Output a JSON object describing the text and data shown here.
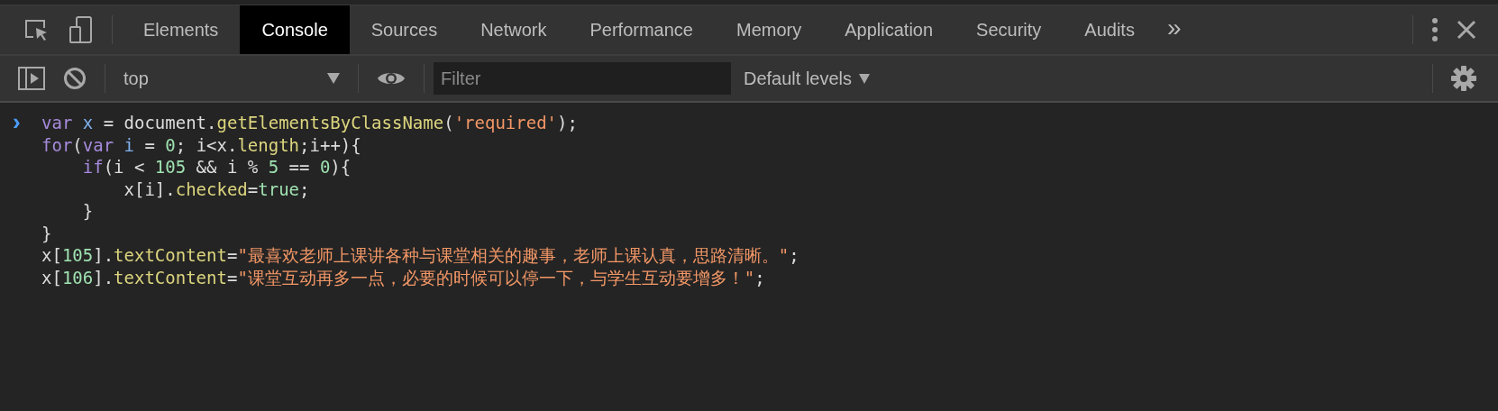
{
  "tabs": [
    {
      "label": "Elements",
      "selected": false
    },
    {
      "label": "Console",
      "selected": true
    },
    {
      "label": "Sources",
      "selected": false
    },
    {
      "label": "Network",
      "selected": false
    },
    {
      "label": "Performance",
      "selected": false
    },
    {
      "label": "Memory",
      "selected": false
    },
    {
      "label": "Application",
      "selected": false
    },
    {
      "label": "Security",
      "selected": false
    },
    {
      "label": "Audits",
      "selected": false
    }
  ],
  "more_tabs": "»",
  "toolbar": {
    "context": "top",
    "filter": {
      "placeholder": "Filter"
    },
    "levels": "Default levels"
  },
  "prompt": "›",
  "code_lines": [
    {
      "tokens": [
        {
          "text": "var",
          "kind": "keyword"
        },
        {
          "text": " x",
          "kind": "variable"
        },
        {
          "text": " = document.",
          "kind": "plain"
        },
        {
          "text": "getElementsByClassName",
          "kind": "property"
        },
        {
          "text": "(",
          "kind": "plain"
        },
        {
          "text": "'required'",
          "kind": "string"
        },
        {
          "text": ");",
          "kind": "plain"
        }
      ]
    },
    {
      "tokens": [
        {
          "text": "for",
          "kind": "keyword"
        },
        {
          "text": "(",
          "kind": "plain"
        },
        {
          "text": "var",
          "kind": "keyword"
        },
        {
          "text": " i",
          "kind": "variable"
        },
        {
          "text": " = ",
          "kind": "plain"
        },
        {
          "text": "0",
          "kind": "number"
        },
        {
          "text": "; i<x.",
          "kind": "plain"
        },
        {
          "text": "length",
          "kind": "property"
        },
        {
          "text": ";i++){",
          "kind": "plain"
        }
      ]
    },
    {
      "tokens": [
        {
          "text": "    if",
          "kind": "keyword"
        },
        {
          "text": "(i < ",
          "kind": "plain"
        },
        {
          "text": "105",
          "kind": "number"
        },
        {
          "text": " && i % ",
          "kind": "plain"
        },
        {
          "text": "5",
          "kind": "number"
        },
        {
          "text": " == ",
          "kind": "plain"
        },
        {
          "text": "0",
          "kind": "number"
        },
        {
          "text": "){",
          "kind": "plain"
        }
      ]
    },
    {
      "tokens": [
        {
          "text": "        x[i].",
          "kind": "plain"
        },
        {
          "text": "checked",
          "kind": "property"
        },
        {
          "text": "=",
          "kind": "plain"
        },
        {
          "text": "true",
          "kind": "atom"
        },
        {
          "text": ";",
          "kind": "plain"
        }
      ]
    },
    {
      "tokens": [
        {
          "text": "    }",
          "kind": "plain"
        }
      ]
    },
    {
      "tokens": [
        {
          "text": "}",
          "kind": "plain"
        }
      ]
    },
    {
      "tokens": [
        {
          "text": "x[",
          "kind": "plain"
        },
        {
          "text": "105",
          "kind": "number"
        },
        {
          "text": "].",
          "kind": "plain"
        },
        {
          "text": "textContent",
          "kind": "property"
        },
        {
          "text": "=",
          "kind": "plain"
        },
        {
          "text": "\"最喜欢老师上课讲各种与课堂相关的趣事，老师上课认真，思路清晰。\"",
          "kind": "string"
        },
        {
          "text": ";",
          "kind": "plain"
        }
      ]
    },
    {
      "tokens": [
        {
          "text": "x[",
          "kind": "plain"
        },
        {
          "text": "106",
          "kind": "number"
        },
        {
          "text": "].",
          "kind": "plain"
        },
        {
          "text": "textContent",
          "kind": "property"
        },
        {
          "text": "=",
          "kind": "plain"
        },
        {
          "text": "\"课堂互动再多一点，必要的时候可以停一下，与学生互动要增多！\"",
          "kind": "string"
        },
        {
          "text": ";",
          "kind": "plain"
        }
      ]
    }
  ]
}
